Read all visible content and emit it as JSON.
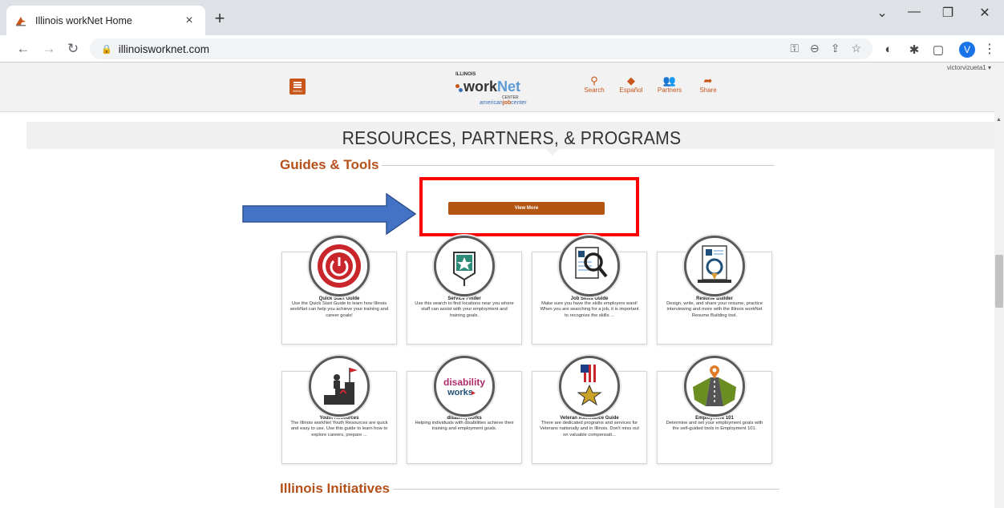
{
  "browser": {
    "tab_title": "Illinois workNet Home",
    "tab_close": "×",
    "new_tab": "+",
    "url": "illinoisworknet.com",
    "avatar_letter": "V"
  },
  "header": {
    "menu_label": "MENU",
    "logo_illinois": "ILLINOIS",
    "logo_work": "work",
    "logo_net": "Net",
    "logo_center": "CENTER",
    "logo_ajc_1": "american",
    "logo_ajc_2": "job",
    "logo_ajc_3": "center",
    "links": [
      {
        "label": "Search",
        "icon": "search-icon"
      },
      {
        "label": "Español",
        "icon": "language-icon"
      },
      {
        "label": "Partners",
        "icon": "partners-icon"
      },
      {
        "label": "Share",
        "icon": "share-icon"
      }
    ],
    "user": "victorvizueta1 ▾"
  },
  "banner_title": "RESOURCES, PARTNERS, & PROGRAMS",
  "guides_title": "Guides & Tools",
  "view_more": "View More",
  "cards": [
    {
      "title": "Quick Start Guide",
      "desc": "Use the Quick Start Guide to learn how Illinois workNet can help you achieve your training and career goals!",
      "icon": "power-icon"
    },
    {
      "title": "Service Finder",
      "desc": "Use this search to find locations near you where staff can assist with your employment and training goals.",
      "icon": "location-star-icon"
    },
    {
      "title": "Job Skills Guide",
      "desc": "Make sure you have the skills employers want! When you are searching for a job, it is important to recognize the skills ...",
      "icon": "magnifier-document-icon"
    },
    {
      "title": "Resume Builder",
      "desc": "Design, write, and share your resume, practice interviewing and more with the Illinois workNet Resume Building tool.",
      "icon": "resume-icon"
    },
    {
      "title": "Youth Resources",
      "desc": "The Illinois workNet Youth Resources are quick and easy to use. Use this guide to learn how to explore careers, prepare ...",
      "icon": "youth-stairs-icon"
    },
    {
      "title": "disabilityworks",
      "desc": "Helping individuals with disabilities achieve their training and employment goals.",
      "icon": "disabilityworks-logo-icon"
    },
    {
      "title": "Veteran Assistance Guide",
      "desc": "There are dedicated programs and services for Veterans nationally and in Illinois. Don't miss out on valuable compensati...",
      "icon": "veteran-flag-star-icon"
    },
    {
      "title": "Employment 101",
      "desc": "Determine and set your employment goals with the self-guided tools in Employment 101.",
      "icon": "road-location-icon"
    }
  ],
  "disability_logo_1": "disability",
  "disability_logo_2": "works",
  "initiatives_title": "Illinois Initiatives",
  "colors": {
    "accent": "#b5501a",
    "button": "#b35612",
    "highlight": "#ff0000",
    "arrow": "#4472c4"
  }
}
